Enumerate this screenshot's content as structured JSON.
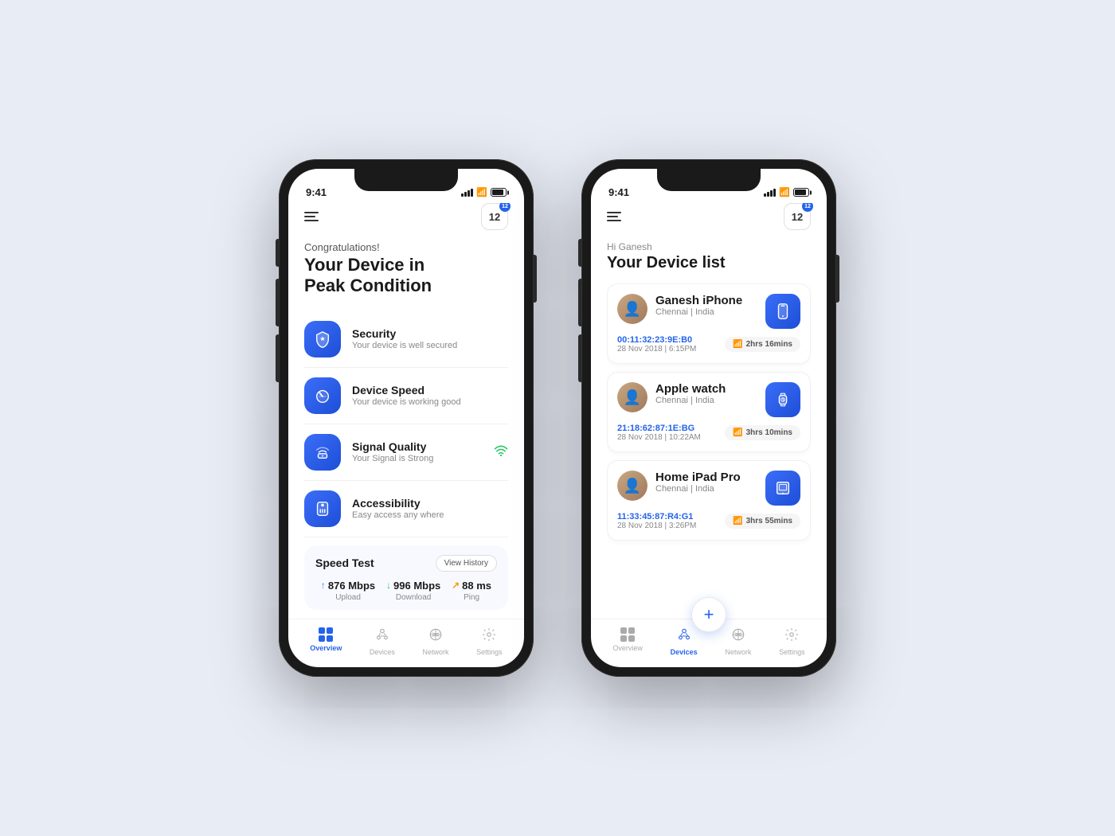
{
  "background": "#e8ecf5",
  "phone1": {
    "statusBar": {
      "time": "9:41",
      "notification": "12"
    },
    "header": {
      "menuIcon": "hamburger-menu",
      "notificationCount": "12"
    },
    "greeting": "Congratulations!",
    "title_line1": "Your Device in",
    "title_line2": "Peak Condition",
    "features": [
      {
        "id": "security",
        "icon": "shield",
        "title": "Security",
        "desc": "Your device is well secured",
        "indicator": ""
      },
      {
        "id": "device-speed",
        "icon": "speedometer",
        "title": "Device Speed",
        "desc": "Your device is working good",
        "indicator": ""
      },
      {
        "id": "signal-quality",
        "icon": "wifi-router",
        "title": "Signal Quality",
        "desc": "Your Signal is Strong",
        "indicator": "wifi"
      },
      {
        "id": "accessibility",
        "icon": "phone-accessibility",
        "title": "Accessibility",
        "desc": "Easy access any where",
        "indicator": ""
      }
    ],
    "speedTest": {
      "title": "Speed Test",
      "viewHistoryLabel": "View History",
      "upload": {
        "value": "876 Mbps",
        "label": "Upload"
      },
      "download": {
        "value": "996 Mbps",
        "label": "Download"
      },
      "ping": {
        "value": "88 ms",
        "label": "Ping"
      }
    },
    "bottomNav": [
      {
        "id": "overview",
        "label": "Overview",
        "active": true
      },
      {
        "id": "devices",
        "label": "Devices",
        "active": false
      },
      {
        "id": "network",
        "label": "Network",
        "active": false
      },
      {
        "id": "settings",
        "label": "Settings",
        "active": false
      }
    ]
  },
  "phone2": {
    "statusBar": {
      "time": "9:41",
      "notification": "12"
    },
    "hiText": "Hi Ganesh",
    "title": "Your Device list",
    "devices": [
      {
        "id": "ganesh-iphone",
        "name": "Ganesh iPhone",
        "location": "Chennai | India",
        "mac": "00:11:32:23:9E:B0",
        "date": "28 Nov 2018 | 6:15PM",
        "wifi": "2hrs 16mins",
        "deviceType": "phone"
      },
      {
        "id": "apple-watch",
        "name": "Apple watch",
        "location": "Chennai | India",
        "mac": "21:18:62:87:1E:BG",
        "date": "28 Nov 2018 | 10:22AM",
        "wifi": "3hrs 10mins",
        "deviceType": "watch"
      },
      {
        "id": "home-ipad",
        "name": "Home iPad Pro",
        "location": "Chennai | India",
        "mac": "11:33:45:87:R4:G1",
        "date": "28 Nov 2018 | 3:26PM",
        "wifi": "3hrs 55mins",
        "deviceType": "tablet"
      }
    ],
    "fab": "+",
    "bottomNav": [
      {
        "id": "overview",
        "label": "Overview",
        "active": false
      },
      {
        "id": "devices",
        "label": "Devices",
        "active": true
      },
      {
        "id": "network",
        "label": "Network",
        "active": false
      },
      {
        "id": "settings",
        "label": "Settings",
        "active": false
      }
    ]
  }
}
